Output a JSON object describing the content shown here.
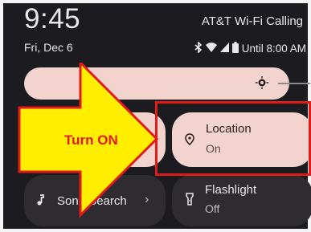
{
  "status_bar": {
    "time": "9:45",
    "date": "Fri, Dec 6",
    "carrier": "AT&T Wi-Fi Calling",
    "alarm": "Until 8:00 AM",
    "icons": [
      "bluetooth-icon",
      "wifi-icon",
      "signal-icon",
      "battery-icon"
    ]
  },
  "brightness": {
    "level": 0.95
  },
  "tiles": {
    "location": {
      "title": "Location",
      "state": "On"
    },
    "song_search": {
      "title": "Song Search",
      "chevron": "›"
    },
    "flashlight": {
      "title": "Flashlight",
      "state": "Off"
    }
  },
  "annotation": {
    "label": "Turn ON"
  },
  "colors": {
    "tile_active": "#f3d3cd",
    "tile_inactive": "#2e2c31",
    "arrow_fill": "#ffee00",
    "annotation_red": "#e11a1a"
  }
}
